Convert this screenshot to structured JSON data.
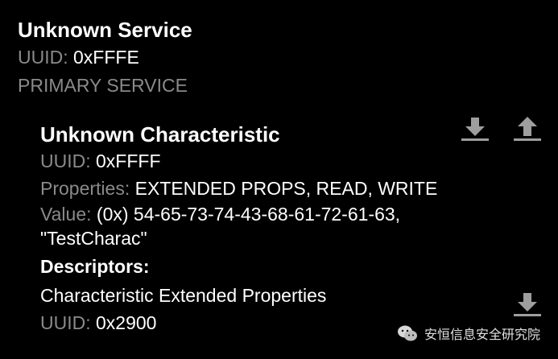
{
  "service": {
    "title": "Unknown Service",
    "uuid_label": "UUID:",
    "uuid_value": "0xFFFE",
    "type": "PRIMARY SERVICE"
  },
  "characteristic": {
    "title": "Unknown Characteristic",
    "uuid_label": "UUID:",
    "uuid_value": "0xFFFF",
    "properties_label": "Properties:",
    "properties_value": "EXTENDED PROPS, READ, WRITE",
    "value_label": "Value:",
    "value_line1": "(0x) 54-65-73-74-43-68-61-72-61-63,",
    "value_line2": "\"TestCharac\"",
    "descriptors_heading": "Descriptors:",
    "descriptor": {
      "name": "Characteristic Extended Properties",
      "uuid_label": "UUID:",
      "uuid_value": "0x2900"
    }
  },
  "icons": {
    "read": "download-icon",
    "write": "upload-icon",
    "descriptor_read": "download-icon"
  },
  "colors": {
    "background": "#000000",
    "text": "#ffffff",
    "label": "#8a8a8a",
    "icon": "#9e9e9e"
  },
  "watermark": {
    "text": "安恒信息安全研究院"
  }
}
